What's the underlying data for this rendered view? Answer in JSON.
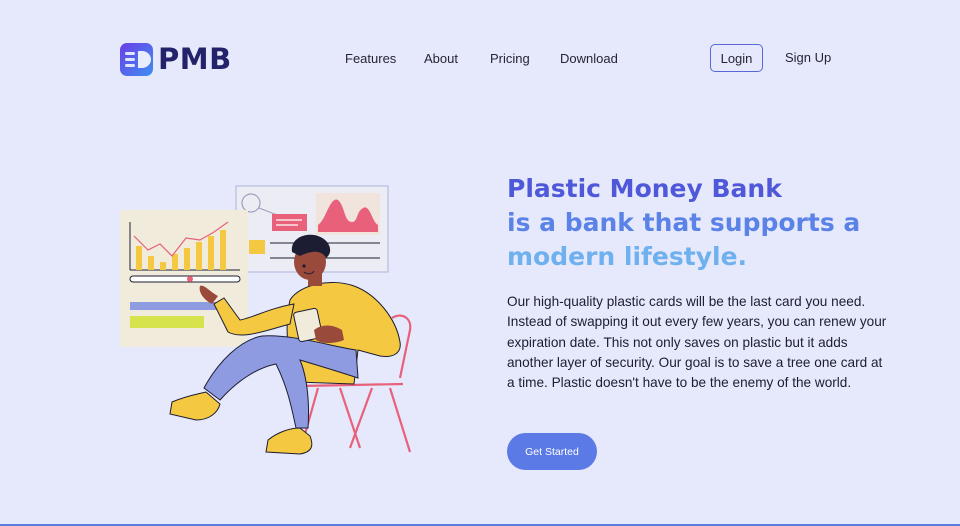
{
  "brand": {
    "name": "PMB"
  },
  "nav": {
    "links": [
      "Features",
      "About",
      "Pricing",
      "Download"
    ],
    "login_label": "Login",
    "signup_label": "Sign Up"
  },
  "hero": {
    "title_line1": "Plastic Money Bank",
    "title_line2": "is a bank that supports a",
    "title_line3": "modern lifestyle.",
    "description": "Our high-quality plastic cards will be the last card you need. Instead of swapping it out every few years, you can renew your expiration date. This not only saves on plastic but it adds another layer of security. Our goal is to save a tree one card at a time. Plastic doesn't have to be the enemy of the world.",
    "cta_label": "Get Started"
  },
  "colors": {
    "background": "#e6e9fc",
    "brand_dark": "#23236b",
    "title_primary": "#4f58d9",
    "title_secondary": "#5b82e6",
    "title_tertiary": "#6fb0ee",
    "button": "#5b7ae6",
    "illustration_yellow": "#f5c842",
    "illustration_purple": "#8f9be0",
    "illustration_pink": "#e8607a"
  },
  "icons": {
    "logo": "card-logo-icon"
  }
}
